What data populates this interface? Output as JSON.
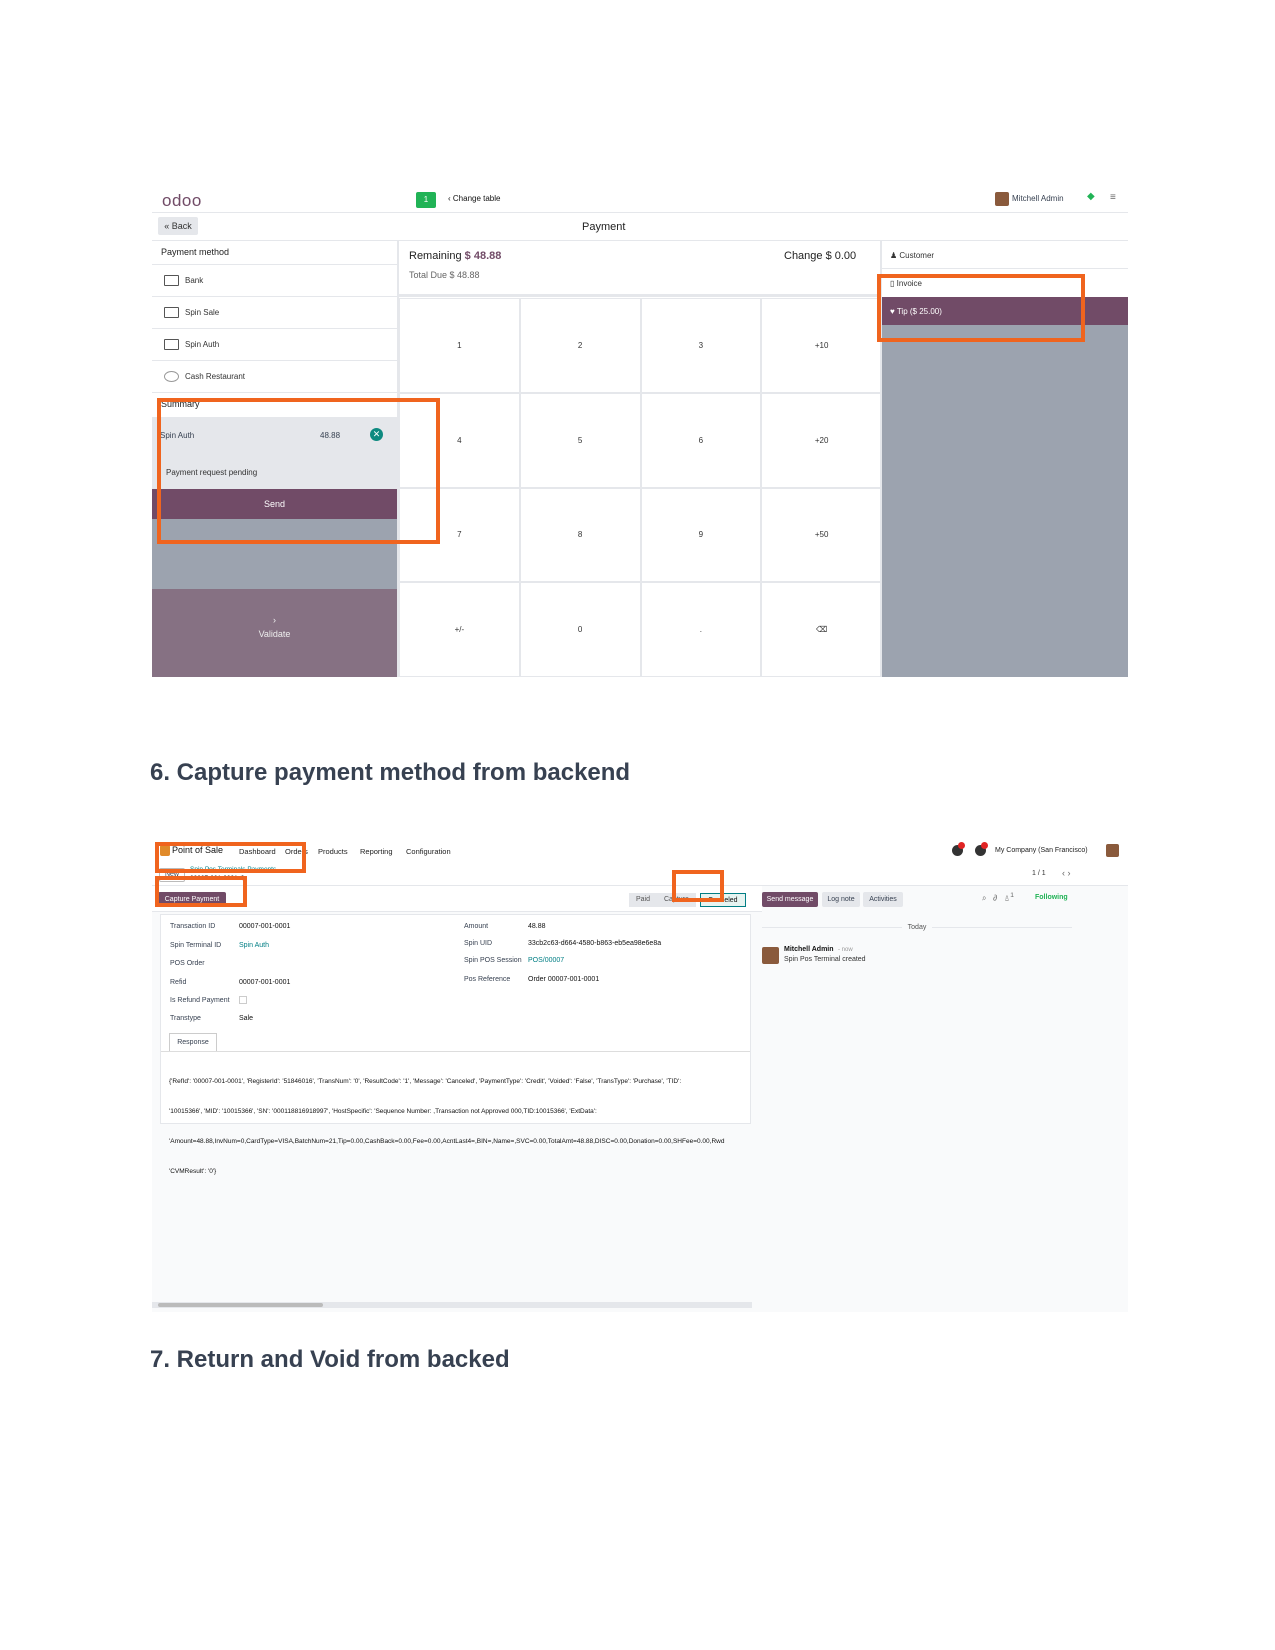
{
  "pos": {
    "logo": "odoo",
    "table_number": "1",
    "change_table": "Change table",
    "user_name": "Mitchell Admin",
    "back_label": "« Back",
    "title": "Payment",
    "payment_method_header": "Payment method",
    "payment_methods": [
      {
        "label": "Bank",
        "icon": "card-icon"
      },
      {
        "label": "Spin Sale",
        "icon": "card-icon"
      },
      {
        "label": "Spin Auth",
        "icon": "card-icon"
      },
      {
        "label": "Cash Restaurant",
        "icon": "cash-icon"
      }
    ],
    "summary_label": "Summary",
    "summary_line": {
      "method": "Spin Auth",
      "amount": "48.88"
    },
    "pending_text": "Payment request pending",
    "send_label": "Send",
    "validate_label": "Validate",
    "remaining_label": "Remaining",
    "remaining_value": "$ 48.88",
    "change_text": "Change $ 0.00",
    "total_due_text": "Total Due $ 48.88",
    "keypad": [
      "1",
      "2",
      "3",
      "+10",
      "4",
      "5",
      "6",
      "+20",
      "7",
      "8",
      "9",
      "+50",
      "+/-",
      "0",
      ".",
      "⌫"
    ],
    "customer_label": "Customer",
    "invoice_label": "Invoice",
    "tip_label": "Tip ($ 25.00)"
  },
  "heading_6": "6. Capture payment method from backend",
  "backend": {
    "app_name": "Point of Sale",
    "menu": [
      "Dashboard",
      "Orders",
      "Products",
      "Reporting",
      "Configuration"
    ],
    "company": "My Company (San Francisco)",
    "new_label": "New",
    "breadcrumb_parent": "Spin Pos Terminals Payments",
    "breadcrumb_record": "00007-001-0001",
    "pager": "1 / 1",
    "capture_payment_label": "Capture Payment",
    "statuses": [
      "Paid",
      "Capture",
      "Canceled"
    ],
    "fields_left": [
      {
        "label": "Transaction ID",
        "value": "00007-001-0001"
      },
      {
        "label": "Spin Terminal ID",
        "value": "Spin Auth"
      },
      {
        "label": "POS Order",
        "value": ""
      },
      {
        "label": "Refid",
        "value": "00007-001-0001"
      },
      {
        "label": "Is Refund Payment",
        "value": ""
      },
      {
        "label": "Transtype",
        "value": "Sale"
      }
    ],
    "fields_right": [
      {
        "label": "Amount",
        "value": "48.88"
      },
      {
        "label": "Spin UID",
        "value": "33cb2c63-d664-4580-b863-eb5ea98e6e8a"
      },
      {
        "label": "Spin POS Session",
        "value": "POS/00007"
      },
      {
        "label": "Pos Reference",
        "value": "Order 00007-001-0001"
      }
    ],
    "response_tab": "Response",
    "response_lines": [
      "{'RefId': '00007-001-0001', 'RegisterId': '51846016', 'TransNum': '0', 'ResultCode': '1', 'Message': 'Canceled', 'PaymentType': 'Credit', 'Voided': 'False', 'TransType': 'Purchase', 'TID':",
      "'10015366', 'MID': '10015366', 'SN': '000118816918997', 'HostSpecific': 'Sequence Number: ,Transaction not Approved 000,TID:10015366', 'ExtData':",
      "'Amount=48.88,InvNum=0,CardType=VISA,BatchNum=21,Tip=0.00,CashBack=0.00,Fee=0.00,AcntLast4=,BIN=,Name=,SVC=0.00,TotalAmt=48.88,DISC=0.00,Donation=0.00,SHFee=0.00,Rwd",
      "'CVMResult': '0'}"
    ],
    "send_message": "Send message",
    "log_note": "Log note",
    "activities": "Activities",
    "followers_count": "1",
    "following": "Following",
    "today": "Today",
    "message_author": "Mitchell Admin",
    "message_time": "- now",
    "message_body": "Spin Pos Terminal created"
  },
  "heading_7": "7. Return and Void from backed",
  "colors": {
    "brand": "#714b67",
    "highlight": "#f0641e",
    "teal": "#017e84",
    "green": "#21b356"
  }
}
